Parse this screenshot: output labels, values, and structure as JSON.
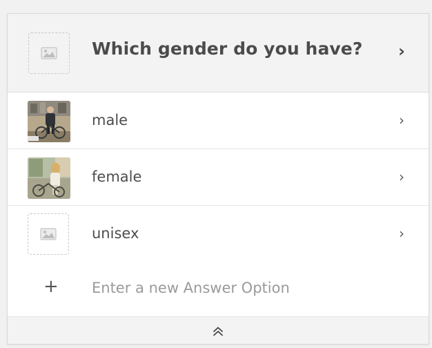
{
  "question": {
    "text": "Which gender do you have?",
    "image_icon": "image-placeholder-icon",
    "chevron_icon": "chevron-right-icon"
  },
  "answers": [
    {
      "label": "male",
      "image": "photo-man-bicycle",
      "chevron_icon": "chevron-right-icon"
    },
    {
      "label": "female",
      "image": "photo-woman-bicycle",
      "chevron_icon": "chevron-right-icon"
    },
    {
      "label": "unisex",
      "image": "image-placeholder-icon",
      "chevron_icon": "chevron-right-icon"
    }
  ],
  "new_answer": {
    "placeholder": "Enter a new Answer Option",
    "icon": "plus-icon"
  },
  "footer": {
    "icon": "double-chevron-up-icon"
  },
  "colors": {
    "header_bg": "#f3f3f3",
    "text": "#4b4b4b",
    "placeholder_text": "#9a9a9a",
    "divider": "#e6e6e6"
  }
}
